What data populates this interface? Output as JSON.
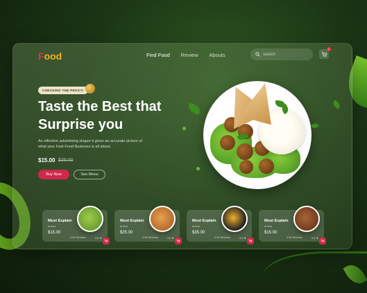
{
  "header": {
    "logo_first": "F",
    "logo_rest": "ood",
    "nav": [
      "Find Food",
      "Review",
      "Abouts"
    ],
    "search_placeholder": "search",
    "cart_count": "1"
  },
  "hero": {
    "badge": "CHECKING THE PROXY!",
    "title": "Taste the Best that Surprise you",
    "description": "An effective advertising slogan it gives an accurate picture of what your Fast Food Business is all about.",
    "price": "$15.00",
    "old_price": "$25.00",
    "buy_label": "Buy Now",
    "menu_label": "See Menu"
  },
  "cards": [
    {
      "title": "Must Explain",
      "sub": "at first",
      "price": "$15.00",
      "reviews": "2.3k  Reviews",
      "rating": "4.5 ★",
      "dish_color": "#7aa83a"
    },
    {
      "title": "Must Explain",
      "sub": "at first",
      "price": "$25.00",
      "reviews": "2.3k  Reviews",
      "rating": "4.5 ★",
      "dish_color": "#d98a3a"
    },
    {
      "title": "Must Explain",
      "sub": "at first",
      "price": "$35.00",
      "reviews": "2.3k  Reviews",
      "rating": "4.5 ★",
      "dish_color": "#e0a030"
    },
    {
      "title": "Must Explain",
      "sub": "at first",
      "price": "$15.00",
      "reviews": "2.3k  Reviews",
      "rating": "4.5 ★",
      "dish_color": "#8a4a2a"
    }
  ],
  "colors": {
    "accent": "#d0284a",
    "logo_red": "#e8303f",
    "logo_yellow": "#f6b11c"
  }
}
